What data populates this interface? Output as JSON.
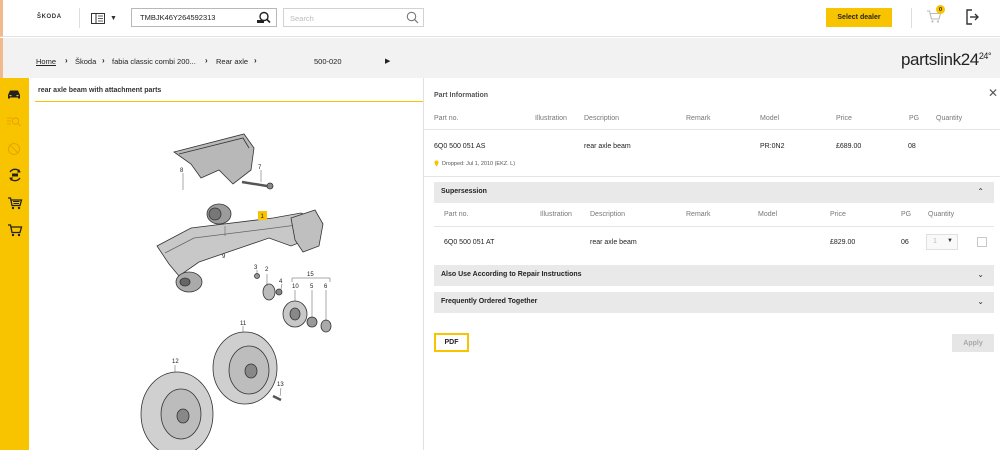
{
  "header": {
    "brand": "ŠKODA",
    "catalog_icon": "catalog-icon",
    "vin_value": "TMBJK46Y264592313",
    "search_placeholder": "Search",
    "dealer_button": "Select dealer",
    "cart_count": "0"
  },
  "breadcrumb": {
    "items": [
      "Home",
      "Škoda",
      "fabia classic combi 200...",
      "Rear axle",
      "500-020"
    ],
    "logo": "partslink24"
  },
  "sidebar": {
    "icons": [
      "car-icon",
      "vin-search-icon",
      "disabled-circle-icon",
      "service-icon",
      "cart-list-icon",
      "cart-icon"
    ]
  },
  "diagram": {
    "title": "rear axle beam with attachment parts",
    "callouts": [
      "8",
      "7",
      "1",
      "9",
      "3",
      "2",
      "4",
      "15",
      "10",
      "5",
      "6",
      "11",
      "12",
      "13"
    ]
  },
  "part_info": {
    "title": "Part Information",
    "columns": [
      "Part no.",
      "Illustration",
      "Description",
      "Remark",
      "Model",
      "Price",
      "PG",
      "Quantity"
    ],
    "row": {
      "part_no": "6Q0 500 051 AS",
      "description": "rear axle beam",
      "model": "PR:0N2",
      "price": "£689.00",
      "pg": "08",
      "note": "Dropped: Jul 1, 2010 (EKZ. L)"
    }
  },
  "supersession": {
    "label": "Supersession",
    "columns": [
      "Part no.",
      "Illustration",
      "Description",
      "Remark",
      "Model",
      "Price",
      "PG",
      "Quantity"
    ],
    "row": {
      "part_no": "6Q0 500 051 AT",
      "description": "rear axle beam",
      "price": "£829.00",
      "pg": "06",
      "qty": "1"
    }
  },
  "sections": {
    "also_use": "Also Use According to Repair Instructions",
    "frequently": "Frequently Ordered Together"
  },
  "buttons": {
    "pdf": "PDF",
    "apply": "Apply"
  },
  "colors": {
    "accent": "#f8c400",
    "panel_gray": "#e9e9e9"
  }
}
